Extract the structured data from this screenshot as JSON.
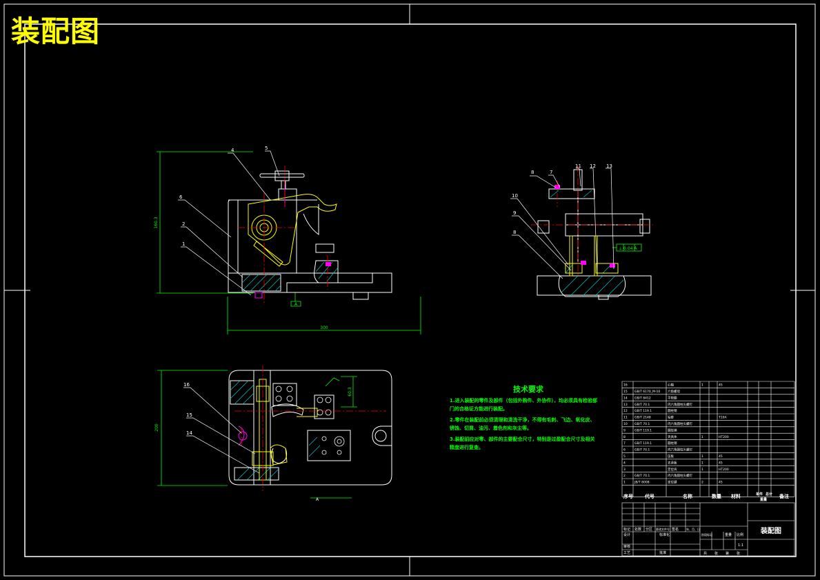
{
  "page_title": "装配图",
  "colors": {
    "background": "#000000",
    "outline": "#ffffff",
    "centerline": "#ff0000",
    "dimension": "#00ff00",
    "leader": "#ffffff",
    "part_yellow": "#ffff00",
    "hatch": "#00cccc",
    "highlight": "#ff00ff"
  },
  "front_view": {
    "balloons": [
      "4",
      "5",
      "6",
      "2",
      "1"
    ],
    "dimensions": {
      "height": "160.3",
      "width": "300"
    },
    "datum": "A"
  },
  "side_view": {
    "balloons": [
      "8",
      "7",
      "11",
      "12",
      "13",
      "10",
      "9",
      "8"
    ],
    "tolerance": "⊥ 0.04 A"
  },
  "top_view": {
    "balloons": [
      "16",
      "15",
      "14"
    ],
    "dimensions": {
      "height": "200",
      "offset": "60.3"
    },
    "datum": "A"
  },
  "technical_requirements": {
    "title": "技术要求",
    "lines": [
      "1.进入装配的零件及部件（包括外购件、外协件），均必须具有检验部",
      "门的合格证方能进行装配。",
      "2.零件在装配前必须清理和清洗干净，不得有毛刺、飞边、氧化皮、",
      "锈蚀、切屑、油污、着色剂和灰尘等。",
      "3.装配前应对零、部件的主要配合尺寸，特别是过盈配合尺寸及相关",
      "精度进行复查。"
    ]
  },
  "title_block": {
    "drawing_name": "装配图",
    "headers": [
      "序号",
      "代号",
      "名称",
      "数量",
      "材料",
      "单件",
      "总计",
      "重量",
      "备注"
    ],
    "sheet_labels": [
      "标记",
      "处数",
      "分区",
      "更改文件号",
      "签名",
      "年、月、日",
      "设计",
      "标准化",
      "阶段标记",
      "重量",
      "比例",
      "审核",
      "工艺",
      "批准",
      "共",
      "张",
      "第",
      "张"
    ],
    "scale": "1:1",
    "rows": [
      {
        "no": "16",
        "name": "心轴",
        "qty": "1",
        "material": "45"
      },
      {
        "no": "15",
        "code": "GB/T 6170_M-10",
        "name": "六角螺母"
      },
      {
        "no": "14",
        "code": "GB/T 8412",
        "name": "平垫圈"
      },
      {
        "no": "13",
        "code": "GB/T 70.1",
        "name": "内六角圆柱头螺钉"
      },
      {
        "no": "12",
        "code": "GB/T 119.1",
        "name": "圆柱销"
      },
      {
        "no": "11",
        "code": "GB/T 2148",
        "name": "钻套",
        "material": "T10A"
      },
      {
        "no": "10",
        "code": "GB/T 70.1",
        "name": "内六角圆柱头螺钉"
      },
      {
        "no": "9",
        "code": "GB/T 119.1",
        "name": "圆柱销"
      },
      {
        "no": "8",
        "name": "夹具体",
        "qty": "1",
        "material": "HT200"
      },
      {
        "no": "7",
        "code": "GB/T 119.1",
        "name": "圆柱销"
      },
      {
        "no": "6",
        "code": "GB/T 70.1",
        "name": "内六角圆柱头螺钉"
      },
      {
        "no": "5",
        "name": "压板",
        "qty": "1",
        "material": "45"
      },
      {
        "no": "4",
        "name": "支承板",
        "qty": "1",
        "material": "45"
      },
      {
        "no": "3",
        "name": "定位块",
        "qty": "1",
        "material": "HT200"
      },
      {
        "no": "2",
        "code": "GB/T 70.1",
        "name": "内六角圆柱头螺钉"
      },
      {
        "no": "1",
        "code": "JB/T 8008",
        "name": "定位键",
        "qty": "2",
        "material": "45"
      }
    ]
  }
}
